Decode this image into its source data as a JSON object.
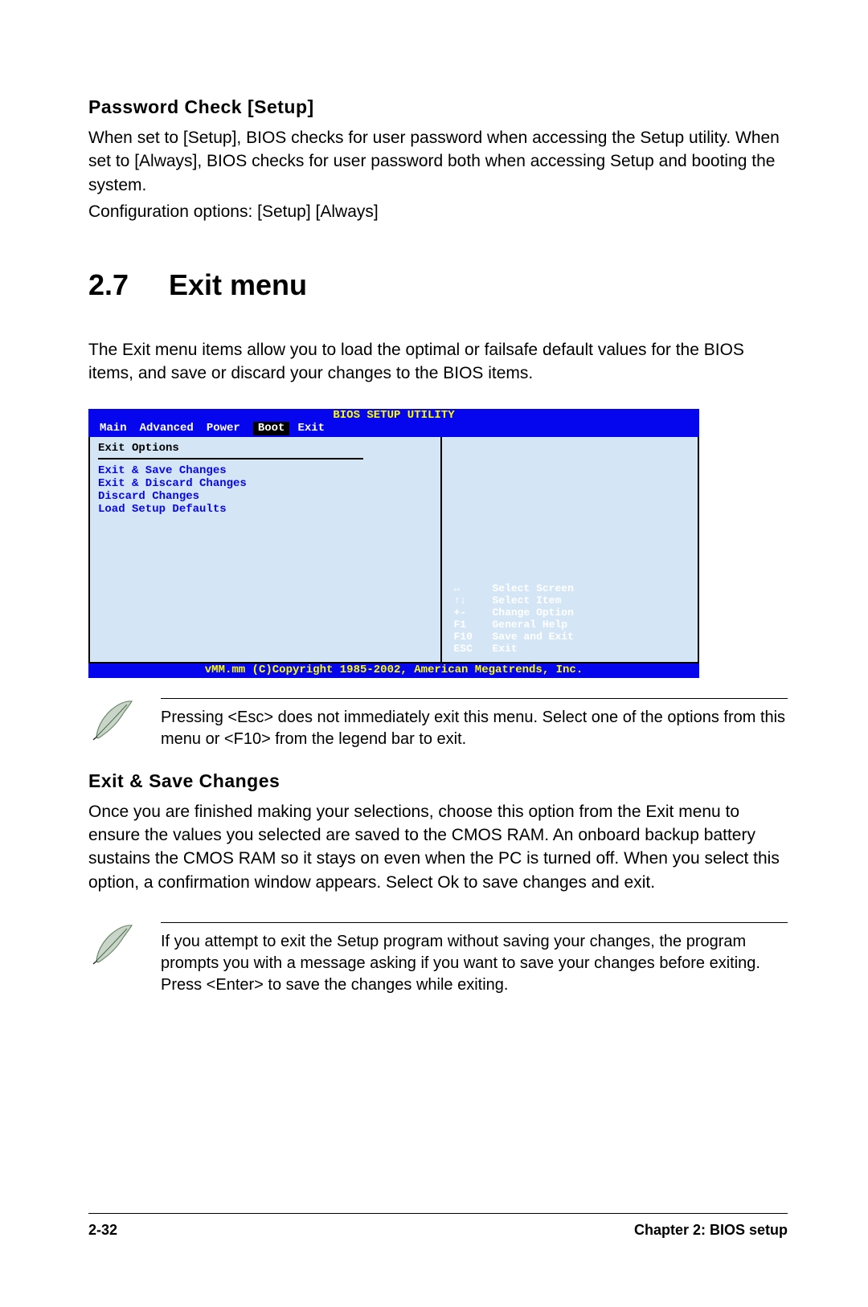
{
  "password_check": {
    "heading": "Password Check [Setup]",
    "p1": "When set to [Setup], BIOS checks for user password when accessing the Setup utility. When set to [Always], BIOS checks for user password both when accessing Setup and booting the system.",
    "p2": "Configuration options: [Setup] [Always]"
  },
  "section": {
    "number": "2.7",
    "title": "Exit menu",
    "intro": "The Exit menu items allow you to load the optimal or failsafe default values for the BIOS items, and save or discard your changes to the BIOS items."
  },
  "bios": {
    "title": "BIOS SETUP UTILITY",
    "menu": [
      "Main",
      "Advanced",
      "Power",
      "Boot",
      "Exit"
    ],
    "selected_menu": "Boot",
    "left_header": "Exit Options",
    "left_items": [
      "Exit & Save Changes",
      "Exit & Discard Changes",
      "Discard Changes",
      "",
      "Load Setup Defaults"
    ],
    "legend": [
      {
        "key": "↔",
        "desc": "Select Screen"
      },
      {
        "key": "↑↓",
        "desc": "Select Item"
      },
      {
        "key": "+-",
        "desc": "Change Option"
      },
      {
        "key": "F1",
        "desc": "General Help"
      },
      {
        "key": "F10",
        "desc": "Save and Exit"
      },
      {
        "key": "ESC",
        "desc": "Exit"
      }
    ],
    "footer": "vMM.mm (C)Copyright 1985-2002, American Megatrends, Inc."
  },
  "note1": "Pressing <Esc> does not immediately exit this menu. Select one of the options from this menu or <F10> from the legend bar to exit.",
  "exit_save": {
    "heading": "Exit & Save Changes",
    "body": "Once you are finished making your selections, choose this option from the Exit menu to ensure the values you selected are saved to the CMOS RAM. An onboard backup battery sustains the CMOS RAM so it stays on even when the PC is turned off. When you select this option, a confirmation window appears. Select Ok to save changes and exit."
  },
  "note2": " If you attempt to exit the Setup program without saving your changes, the program prompts you with a message asking if you want to save your changes before exiting. Press <Enter>  to save the  changes while exiting.",
  "footer": {
    "page": "2-32",
    "chapter": "Chapter 2: BIOS setup"
  }
}
